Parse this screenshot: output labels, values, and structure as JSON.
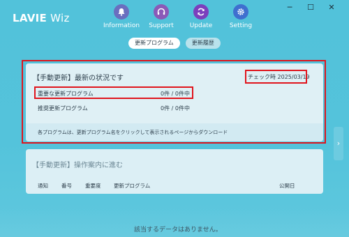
{
  "app": {
    "brand_lavie": "LAVIE",
    "brand_wiz": "Wiz"
  },
  "window_controls": {
    "minimize": "─",
    "maximize": "☐",
    "close": "✕"
  },
  "nav": [
    {
      "label": "Information",
      "icon": "bell-icon"
    },
    {
      "label": "Support",
      "icon": "headset-icon"
    },
    {
      "label": "Update",
      "icon": "refresh-icon"
    },
    {
      "label": "Setting",
      "icon": "gear-icon"
    }
  ],
  "tabs": {
    "update_program": "更新プログラム",
    "update_history": "更新履歴"
  },
  "manual_update_status": {
    "title": "【手動更新】最新の状況です",
    "check_time": "チェック時 2025/03/19",
    "important_label": "重要な更新プログラム",
    "important_count": "0件 / 0件中",
    "recommended_label": "推奨更新プログラム",
    "recommended_count": "0件 / 0件中",
    "footer_note": "各プログラムは、更新プログラム名をクリックして表示されるページからダウンロード"
  },
  "manual_update_guide": {
    "title": "【手動更新】操作案内に進む",
    "columns": [
      "通知",
      "番号",
      "重要度",
      "更新プログラム",
      "公開日"
    ]
  },
  "empty_message": "該当するデータはありません。",
  "right_arrow": "›",
  "colors": {
    "background": "#52c2da",
    "highlight": "#e0141c",
    "update_active": "#7b3fbd"
  }
}
